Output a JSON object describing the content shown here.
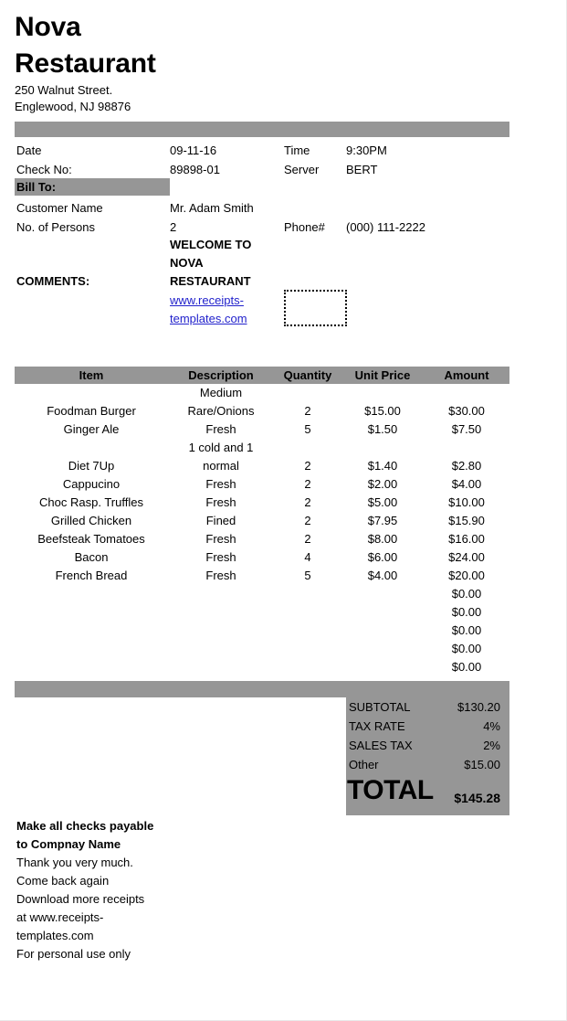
{
  "business": {
    "name_line1": "Nova",
    "name_line2": "Restaurant",
    "address_line1": "250 Walnut Street.",
    "address_line2": "Englewood, NJ 98876"
  },
  "meta": {
    "date_label": "Date",
    "date_value": "09-11-16",
    "time_label": "Time",
    "time_value": "9:30PM",
    "check_label": "Check No:",
    "check_value": "89898-01",
    "server_label": "Server",
    "server_value": "BERT"
  },
  "bill_to": {
    "heading": "Bill To:",
    "customer_label": "Customer Name",
    "customer_value": "Mr. Adam Smith",
    "persons_label": "No. of Persons",
    "persons_value": "2",
    "phone_label": "Phone#",
    "phone_value": "(000) 111-2222"
  },
  "comments": {
    "label": "COMMENTS:",
    "welcome_text": "WELCOME TO NOVA RESTAURANT",
    "link_text": "www.receipts-templates.com"
  },
  "items_table": {
    "columns": [
      "Item",
      "Description",
      "Quantity",
      "Unit Price",
      "Amount"
    ],
    "rows": [
      {
        "item": "Foodman Burger",
        "description_line1": "Medium",
        "description_line2": "Rare/Onions",
        "quantity": "2",
        "unit_price": "$15.00",
        "amount": "$30.00"
      },
      {
        "item": "Ginger Ale",
        "description_line1": "",
        "description_line2": "Fresh",
        "quantity": "5",
        "unit_price": "$1.50",
        "amount": "$7.50"
      },
      {
        "item": "Diet 7Up",
        "description_line1": "1 cold and 1",
        "description_line2": "normal",
        "quantity": "2",
        "unit_price": "$1.40",
        "amount": "$2.80"
      },
      {
        "item": "Cappucino",
        "description_line1": "",
        "description_line2": "Fresh",
        "quantity": "2",
        "unit_price": "$2.00",
        "amount": "$4.00"
      },
      {
        "item": "Choc Rasp. Truffles",
        "description_line1": "",
        "description_line2": "Fresh",
        "quantity": "2",
        "unit_price": "$5.00",
        "amount": "$10.00"
      },
      {
        "item": "Grilled Chicken",
        "description_line1": "",
        "description_line2": "Fined",
        "quantity": "2",
        "unit_price": "$7.95",
        "amount": "$15.90"
      },
      {
        "item": "Beefsteak Tomatoes",
        "description_line1": "",
        "description_line2": "Fresh",
        "quantity": "2",
        "unit_price": "$8.00",
        "amount": "$16.00"
      },
      {
        "item": "Bacon",
        "description_line1": "",
        "description_line2": "Fresh",
        "quantity": "4",
        "unit_price": "$6.00",
        "amount": "$24.00"
      },
      {
        "item": "French Bread",
        "description_line1": "",
        "description_line2": "Fresh",
        "quantity": "5",
        "unit_price": "$4.00",
        "amount": "$20.00"
      },
      {
        "item": "",
        "description_line1": "",
        "description_line2": "",
        "quantity": "",
        "unit_price": "",
        "amount": "$0.00"
      },
      {
        "item": "",
        "description_line1": "",
        "description_line2": "",
        "quantity": "",
        "unit_price": "",
        "amount": "$0.00"
      },
      {
        "item": "",
        "description_line1": "",
        "description_line2": "",
        "quantity": "",
        "unit_price": "",
        "amount": "$0.00"
      },
      {
        "item": "",
        "description_line1": "",
        "description_line2": "",
        "quantity": "",
        "unit_price": "",
        "amount": "$0.00"
      },
      {
        "item": "",
        "description_line1": "",
        "description_line2": "",
        "quantity": "",
        "unit_price": "",
        "amount": "$0.00"
      }
    ]
  },
  "totals": {
    "subtotal_label": "SUBTOTAL",
    "subtotal_value": "$130.20",
    "tax_rate_label": "TAX RATE",
    "tax_rate_value": "4%",
    "sales_tax_label": "SALES TAX",
    "sales_tax_value": "2%",
    "other_label": "Other",
    "other_value": "$15.00",
    "total_label": "TOTAL",
    "total_value": "$145.28"
  },
  "footer": {
    "line1": "Make all checks payable",
    "line2": "to Compnay Name",
    "line3": "Thank you very much.",
    "line4": "Come back again",
    "line5": "Download more receipts",
    "line6": "at www.receipts-",
    "line7": "templates.com",
    "line8": "For personal use only"
  },
  "colors": {
    "gray_bar": "#969696",
    "link": "#2222cc"
  }
}
